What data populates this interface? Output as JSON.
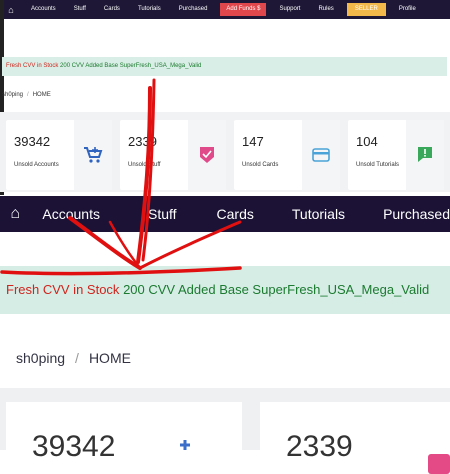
{
  "small_nav": {
    "items": [
      "Accounts",
      "Stuff",
      "Cards",
      "Tutorials",
      "Purchased",
      "Add Funds $",
      "Support",
      "Rules",
      "SELLER",
      "Profile"
    ]
  },
  "small_banner": {
    "red_text": "Fresh CVV in Stock",
    "green_text": "200 CVV Added Base SuperFresh_USA_Mega_Valid"
  },
  "small_breadcrumb": {
    "shop": "sh0ping",
    "home": "HOME",
    "sep": "/"
  },
  "small_cards": [
    {
      "value": "39342",
      "label": "Unsold Accounts",
      "icon": "cart-icon",
      "color": "#2f63c0"
    },
    {
      "value": "2339",
      "label": "Unsold Stuff",
      "icon": "shield-check-icon",
      "color": "#e04a8a"
    },
    {
      "value": "147",
      "label": "Unsold Cards",
      "icon": "card-icon",
      "color": "#4aa3d8"
    },
    {
      "value": "104",
      "label": "Unsold Tutorials",
      "icon": "chat-alert-icon",
      "color": "#3aa85a"
    }
  ],
  "big_nav": {
    "items": [
      "Accounts",
      "Stuff",
      "Cards",
      "Tutorials",
      "Purchased"
    ]
  },
  "big_banner": {
    "red_text": "Fresh CVV in Stock",
    "green_text": "200 CVV Added Base SuperFresh_USA_Mega_Valid"
  },
  "big_breadcrumb": {
    "shop": "sh0ping",
    "home": "HOME",
    "sep": "/"
  },
  "big_cards": [
    {
      "value": "39342"
    },
    {
      "value": "2339"
    }
  ],
  "colors": {
    "nav_bg": "#1e1736",
    "banner_bg": "#d9eee6",
    "red": "#d0241c",
    "green": "#1b7a2f",
    "arrow": "#e01010"
  }
}
